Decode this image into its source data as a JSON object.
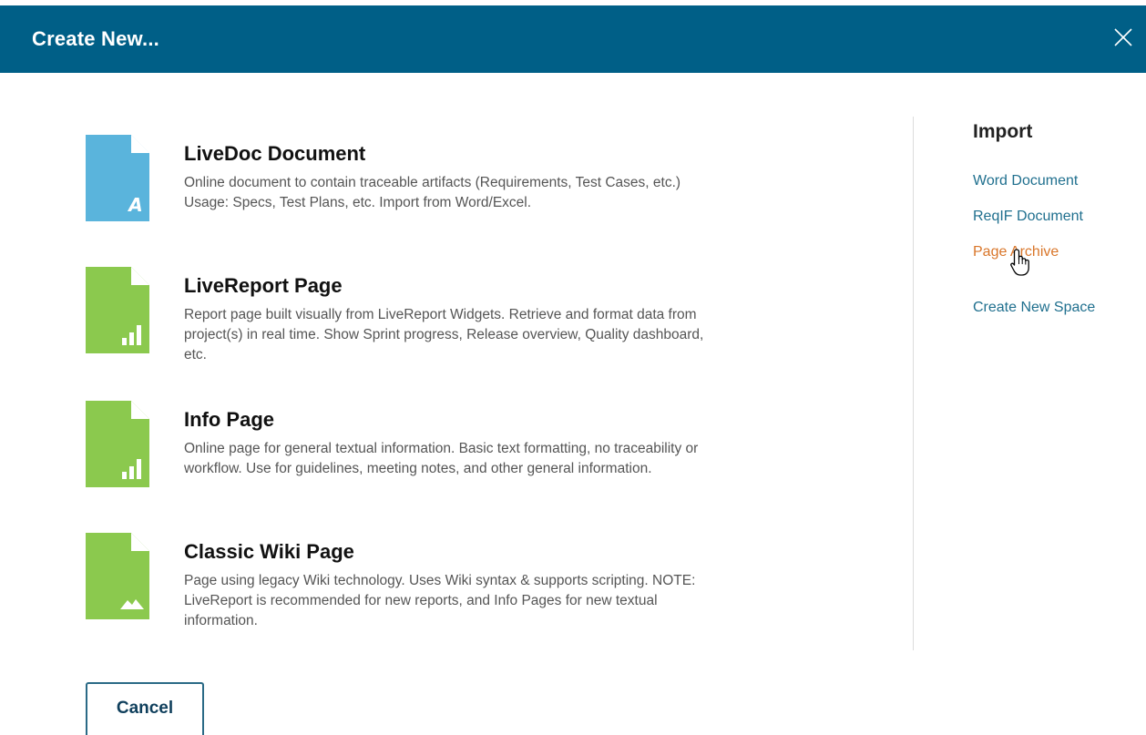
{
  "dialog": {
    "title": "Create New...",
    "close_icon": "close-icon"
  },
  "items": [
    {
      "title": "LiveDoc Document",
      "desc_lines": [
        "Online document to contain traceable artifacts (Requirements, Test Cases, etc.)",
        "Usage: Specs, Test Plans, etc. Import from Word/Excel."
      ],
      "icon": "livedoc-document-icon",
      "icon_color": "#5ab4dc"
    },
    {
      "title": "LiveReport Page",
      "desc_lines": [
        "Report page built visually from LiveReport Widgets. Retrieve and format data from",
        "project(s) in real time. Show Sprint progress, Release overview, Quality dashboard,",
        "etc."
      ],
      "icon": "livereport-page-icon",
      "icon_color": "#8bc94e"
    },
    {
      "title": "Info Page",
      "desc_lines": [
        "Online page for general textual information. Basic text formatting, no traceability or",
        "workflow. Use for guidelines, meeting notes, and other general information."
      ],
      "icon": "info-page-icon",
      "icon_color": "#8bc94e"
    },
    {
      "title": "Classic Wiki Page",
      "desc_lines": [
        "Page using legacy Wiki technology. Uses Wiki syntax & supports scripting. NOTE:",
        "LiveReport is recommended for new reports, and Info Pages for new textual",
        "information."
      ],
      "icon": "classic-wiki-page-icon",
      "icon_color": "#8bc94e"
    }
  ],
  "import": {
    "title": "Import",
    "links": [
      "Word Document",
      "ReqIF Document",
      "Page Archive"
    ]
  },
  "create_space_link": "Create New Space",
  "colors": {
    "header": "#005f87",
    "link": "#1f6f8e",
    "link_hover": "#d9762a"
  },
  "footer": {
    "cancel_label": "Cancel"
  }
}
